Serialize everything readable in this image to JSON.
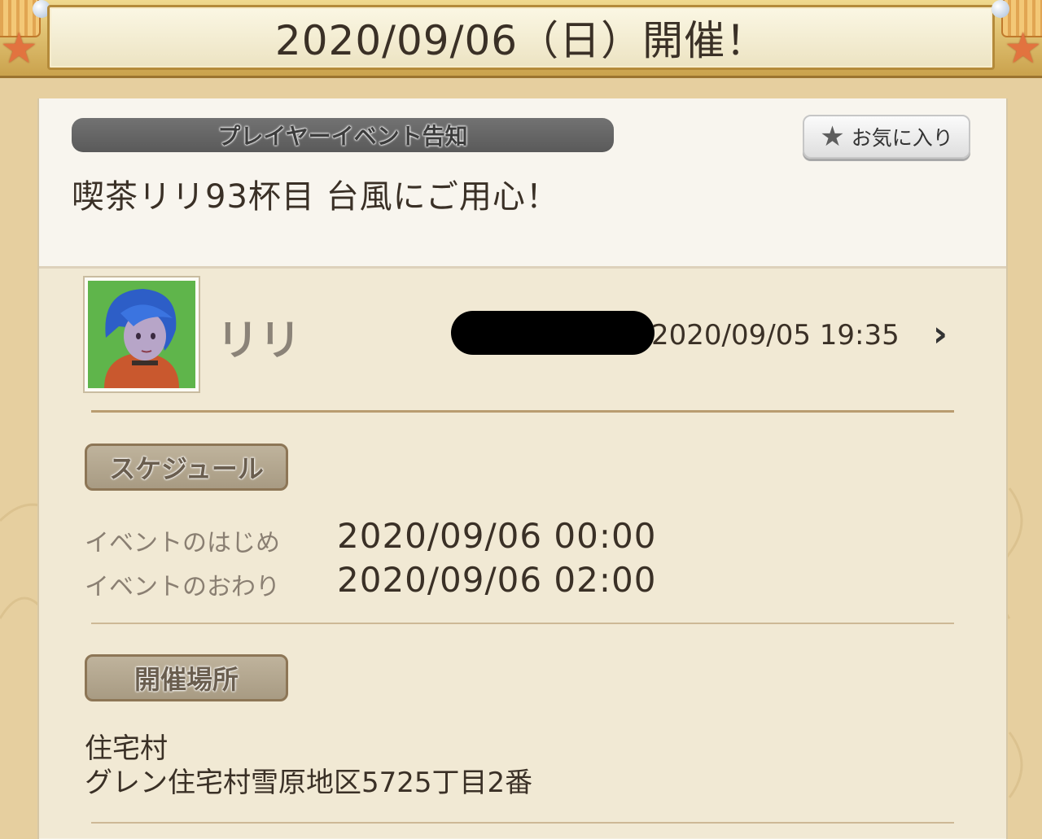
{
  "banner": {
    "title": "2020/09/06（日）開催！"
  },
  "event": {
    "category": "プレイヤーイベント告知",
    "title": "喫茶リリ93杯目  台風にご用心！",
    "favorite_label": "お気に入り"
  },
  "author": {
    "name": "リリ",
    "posted_at": "2020/09/05  19:35"
  },
  "schedule": {
    "heading": "スケジュール",
    "start_label": "イベントのはじめ",
    "start_value": "2020/09/06  00:00",
    "end_label": "イベントのおわり",
    "end_value": "2020/09/06  02:00"
  },
  "venue": {
    "heading": "開催場所",
    "line1": "住宅村",
    "line2": "グレン住宅村雪原地区5725丁目2番"
  },
  "icons": {
    "favorite": "star-icon",
    "detail": "chevron-right-icon",
    "decoration": [
      "shell-icon",
      "starfish-icon",
      "pearl-icon"
    ]
  },
  "colors": {
    "background": "#e6cf9f",
    "card": "#f5efe0",
    "category_pill": "#5f5f5f",
    "section_tag": "#b3a68f",
    "text": "#3a3026"
  }
}
